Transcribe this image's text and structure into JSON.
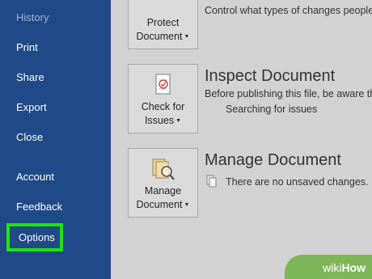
{
  "sidebar": {
    "items": [
      {
        "label": "History"
      },
      {
        "label": "Print"
      },
      {
        "label": "Share"
      },
      {
        "label": "Export"
      },
      {
        "label": "Close"
      },
      {
        "label": "Account"
      },
      {
        "label": "Feedback"
      },
      {
        "label": "Options"
      }
    ],
    "colors": {
      "background": "#1f4a87",
      "highlight": "#20e30f"
    }
  },
  "protect": {
    "button_line1": "Protect",
    "button_line2": "Document",
    "description": "Control what types of changes people"
  },
  "inspect": {
    "button_line1": "Check for",
    "button_line2": "Issues",
    "title": "Inspect Document",
    "description": "Before publishing this file, be aware th",
    "status": "Searching for issues"
  },
  "manage": {
    "button_line1": "Manage",
    "button_line2": "Document",
    "title": "Manage Document",
    "status": "There are no unsaved changes."
  },
  "watermark": {
    "prefix": "wiki",
    "suffix": "How"
  }
}
